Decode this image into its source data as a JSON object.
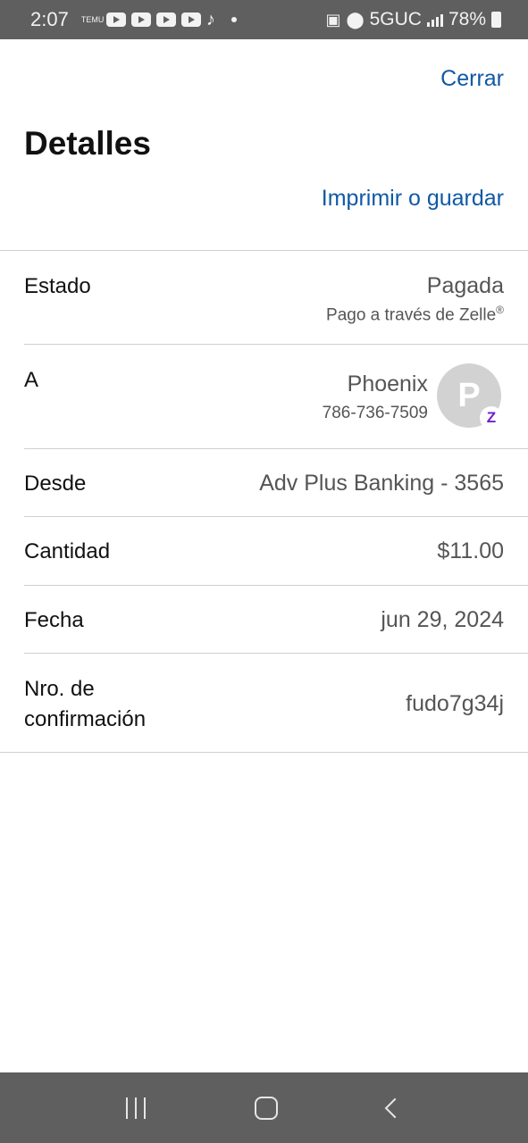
{
  "status_bar": {
    "time": "2:07",
    "app_label": "TEMU",
    "network": "5GUC",
    "battery": "78%"
  },
  "header": {
    "close_label": "Cerrar",
    "title": "Detalles",
    "print_label": "Imprimir o guardar"
  },
  "details": {
    "status": {
      "label": "Estado",
      "value": "Pagada",
      "sub_text": "Pago a través de Zelle",
      "sub_mark": "®"
    },
    "recipient": {
      "label": "A",
      "name": "Phoenix",
      "phone": "786-736-7509",
      "avatar_initial": "P",
      "badge": "Z"
    },
    "from": {
      "label": "Desde",
      "value": "Adv Plus Banking - 3565"
    },
    "amount": {
      "label": "Cantidad",
      "value": "$11.00"
    },
    "date": {
      "label": "Fecha",
      "value": "jun 29, 2024"
    },
    "confirmation": {
      "label_line1": "Nro. de",
      "label_line2": "confirmación",
      "value": "fudo7g34j"
    }
  },
  "colors": {
    "link": "#0f59a6",
    "zelle": "#6d1ed4",
    "system_bar": "#5f5f5f"
  }
}
